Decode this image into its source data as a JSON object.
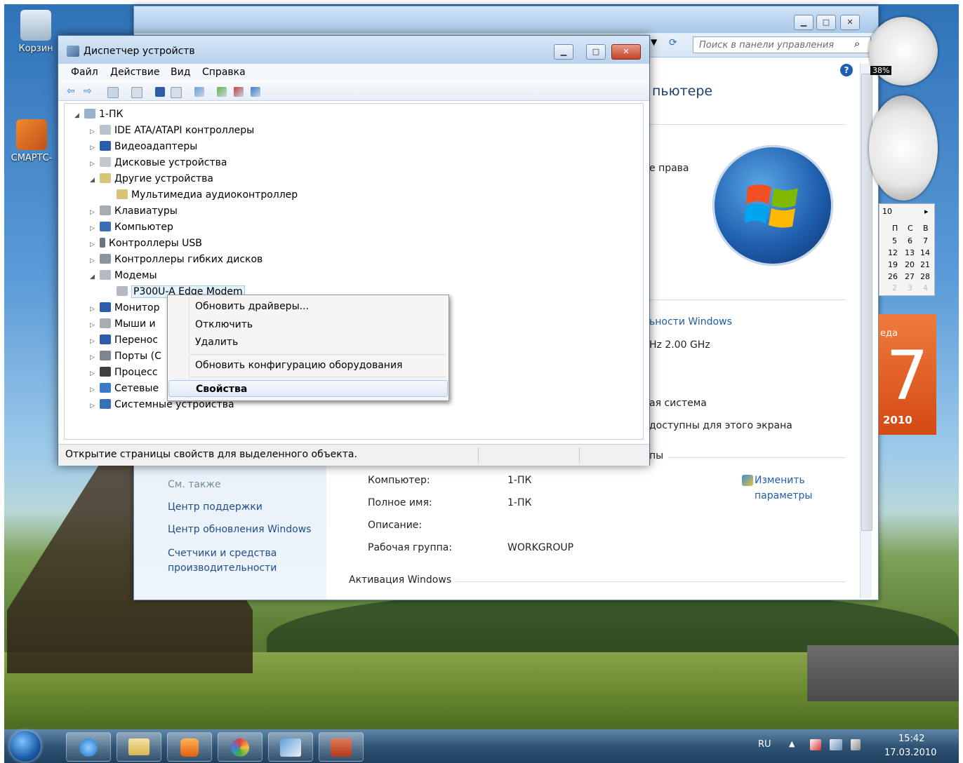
{
  "desktop": {
    "icons": [
      {
        "label": "Корзин"
      },
      {
        "label": "СМАРТС-"
      }
    ]
  },
  "system_window": {
    "search_placeholder": "Поиск в панели управления",
    "heading_fragment": "пьютере",
    "rights_fragment": "е права",
    "perf_link_fragment": "ьности Windows",
    "cpu_fragment": "Hz  2.00 GHz",
    "system_type_fragment": "ая система",
    "touch_fragment": "доступны для этого экрана",
    "group_fragment": "пы",
    "see_also_label": "См. также",
    "sidebar_links": [
      "Центр поддержки",
      "Центр обновления Windows",
      "Счетчики и средства производительности"
    ],
    "rows": [
      {
        "label": "Компьютер:",
        "value": "1-ПК"
      },
      {
        "label": "Полное имя:",
        "value": "1-ПК"
      },
      {
        "label": "Описание:",
        "value": ""
      },
      {
        "label": "Рабочая группа:",
        "value": "WORKGROUP"
      }
    ],
    "change_link_line1": "Изменить",
    "change_link_line2": "параметры",
    "activation_label": "Активация Windows"
  },
  "gadgets": {
    "cpu_percent": "38%",
    "calendar": {
      "month": "10",
      "header": [
        "П",
        "С",
        "В"
      ],
      "rows": [
        [
          "5",
          "6",
          "7"
        ],
        [
          "12",
          "13",
          "14"
        ],
        [
          "19",
          "20",
          "21"
        ],
        [
          "26",
          "27",
          "28"
        ],
        [
          "2",
          "3",
          "4"
        ]
      ]
    },
    "big_day": "7",
    "big_year": "2010",
    "big_weekday_fragment": "еда"
  },
  "device_manager": {
    "title": "Диспетчер устройств",
    "menu": [
      "Файл",
      "Действие",
      "Вид",
      "Справка"
    ],
    "tree": {
      "root": "1-ПК",
      "items": [
        "IDE ATA/ATAPI контроллеры",
        "Видеоадаптеры",
        "Дисковые устройства",
        "Другие устройства",
        "Мультимедиа аудиоконтроллер",
        "Клавиатуры",
        "Компьютер",
        "Контроллеры USB",
        "Контроллеры гибких дисков",
        "Модемы",
        "P300U-A Edge Modem",
        "Монитор",
        "Мыши и",
        "Перенос",
        "Порты (С",
        "Процесс",
        "Сетевые",
        "Системные устройства"
      ]
    },
    "status_text": "Открытие страницы свойств для выделенного объекта."
  },
  "context_menu": {
    "items": [
      "Обновить драйверы...",
      "Отключить",
      "Удалить",
      "Обновить конфигурацию оборудования",
      "Свойства"
    ]
  },
  "taskbar": {
    "lang": "RU",
    "time": "15:42",
    "date": "17.03.2010"
  }
}
